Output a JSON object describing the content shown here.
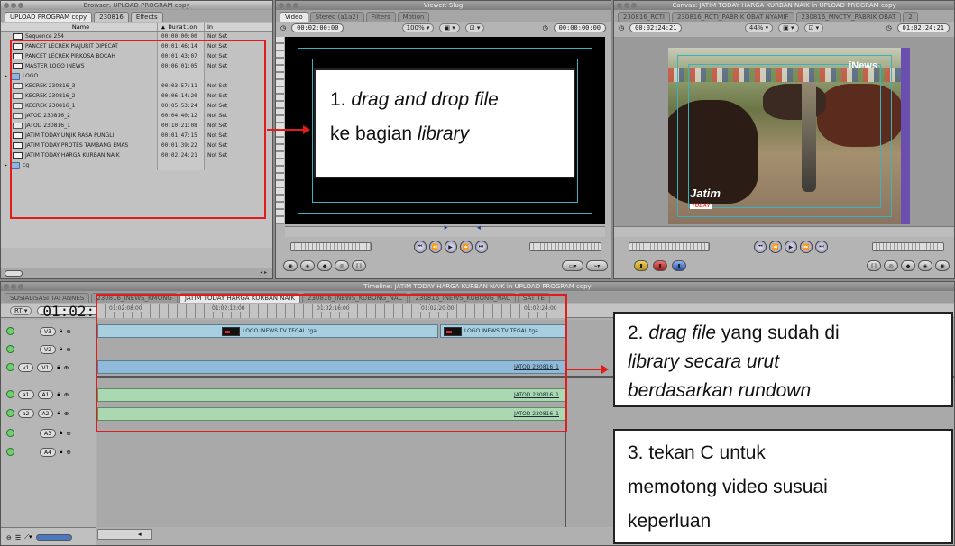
{
  "browser": {
    "title": "Browser: UPLOAD PROGRAM copy",
    "tabs": [
      "UPLOAD PROGRAM copy",
      "230816",
      "Effects"
    ],
    "columns": {
      "name": "Name",
      "duration": "Duration",
      "in": "In"
    },
    "items": [
      {
        "type": "seq",
        "name": "Sequence 254",
        "duration": "00:00:00:00",
        "in": "Not Set"
      },
      {
        "type": "seq",
        "name": "PANCET LECREK PIAJURIT DIPECAT",
        "duration": "00:01:46:14",
        "in": "Not Set"
      },
      {
        "type": "seq",
        "name": "PANCET LECREK PIRKOSA BOCAH",
        "duration": "00:01:43:07",
        "in": "Not Set"
      },
      {
        "type": "seq",
        "name": "MASTER LOGO INEWS",
        "duration": "00:06:01:05",
        "in": "Not Set"
      },
      {
        "type": "folder",
        "name": "LOGO",
        "duration": "",
        "in": ""
      },
      {
        "type": "clip",
        "name": "KECREK 230816_3",
        "duration": "00:03:57:11",
        "in": "Not Set"
      },
      {
        "type": "clip",
        "name": "KECREK 230816_2",
        "duration": "00:06:14:20",
        "in": "Not Set"
      },
      {
        "type": "clip",
        "name": "KECREK 230816_1",
        "duration": "00:05:53:24",
        "in": "Not Set"
      },
      {
        "type": "clip",
        "name": "JATOD 230816_2",
        "duration": "00:04:40:12",
        "in": "Not Set"
      },
      {
        "type": "clip",
        "name": "JATOD 230816_1",
        "duration": "00:10:21:08",
        "in": "Not Set"
      },
      {
        "type": "seq",
        "name": "JATIM TODAY UNJIK RASA PUNGLI",
        "duration": "00:01:47:15",
        "in": "Not Set"
      },
      {
        "type": "seq",
        "name": "JATIM TODAY PROTES TAMBANG EMAS",
        "duration": "00:01:39:22",
        "in": "Not Set"
      },
      {
        "type": "seq",
        "name": "JATIM TODAY HARGA KURBAN NAIK",
        "duration": "00:02:24:21",
        "in": "Not Set"
      },
      {
        "type": "folder",
        "name": "cg",
        "duration": "",
        "in": ""
      }
    ]
  },
  "viewer": {
    "title": "Viewer: Slug",
    "tabs": [
      "Video",
      "Stereo (a1a2)",
      "Filters",
      "Motion"
    ],
    "timecode_left": "00:02:00:00",
    "zoom": "100%",
    "timecode_right": "00:00:00:00"
  },
  "canvas": {
    "title": "Canvas: JATIM TODAY HARGA KURBAN NAIK in UPLOAD PROGRAM copy",
    "tabs": [
      "230816_RCTI",
      "230816_RCTI_PABRIK OBAT NYAMIF",
      "230816_MNCTV_PABRIK OBAT",
      "2"
    ],
    "timecode_left": "00:02:24:21",
    "zoom": "44%",
    "timecode_right": "01:02:24:21",
    "overlay_top": "News",
    "overlay_bottom": "Jatim",
    "overlay_bottom_sub": "TODAY"
  },
  "timeline": {
    "title": "Timeline: JATIM TODAY HARGA KURBAN NAIK in UPLOAD PROGRAM copy",
    "tabs": [
      "SOSIALISASI TAI ANNES",
      "230816_INEWS_KMONG",
      "JATIM TODAY HARGA KURBAN NAIK",
      "230816_INEWS_KUBONG_NAC",
      "230816_INEWS_KUBONG_NAC",
      "SAT TE"
    ],
    "rt": "RT",
    "current_tc": "01:02:24:21",
    "ruler": [
      "01:02:08:00",
      "01:02:12:00",
      "01:02:16:00",
      "01:02:20:00",
      "01:02:24:00"
    ],
    "tracks": [
      {
        "src": "",
        "dst": "V3"
      },
      {
        "src": "",
        "dst": "V2"
      },
      {
        "src": "v1",
        "dst": "V1"
      },
      {
        "src": "a1",
        "dst": "A1"
      },
      {
        "src": "a2",
        "dst": "A2"
      },
      {
        "src": "",
        "dst": "A3"
      },
      {
        "src": "",
        "dst": "A4"
      }
    ],
    "clips": {
      "v3_a": "LOGO INEWS TV TEGAL.tga",
      "v3_b": "LOGO INEWS TV TEGAL.tga",
      "v1": "JATOD 230816_1",
      "a1": "JATOD 230816_1",
      "a2": "JATOD 230816_1"
    }
  },
  "annotations": {
    "step1_parts": [
      "1. ",
      "drag and drop file",
      "ke bagian ",
      "library"
    ],
    "step2_parts": [
      "2. ",
      "drag file",
      " yang sudah di",
      "library secara urut",
      "berdasarkan rundown"
    ],
    "step3_lines": [
      "3. tekan C untuk",
      "memotong video susuai",
      "keperluan"
    ]
  },
  "colors": {
    "highlight": "#e21b1b",
    "clip_video": "#a7cfe0",
    "clip_audio": "#a9d8b1"
  }
}
